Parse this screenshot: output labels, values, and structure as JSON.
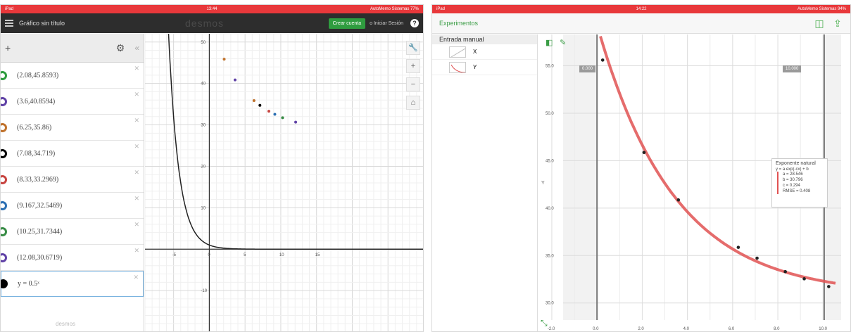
{
  "left": {
    "statusbar": {
      "left": "iPad",
      "center": "13:44",
      "right": "AutoMemo Sistemas  77%"
    },
    "header": {
      "title": "Gráfico sin título",
      "logo": "desmos",
      "create_account": "Crear cuenta",
      "login": "o Iniciar Sesión",
      "help": "?"
    },
    "toolbar": {
      "add": "+",
      "settings": "⚙",
      "collapse": "«"
    },
    "expressions": [
      {
        "text": "(2.08,45.8593)",
        "color": "#2f9c3f"
      },
      {
        "text": "(3.6,40.8594)",
        "color": "#6042a6"
      },
      {
        "text": "(6.25,35.86)",
        "color": "#c0722c"
      },
      {
        "text": "(7.08,34.719)",
        "color": "#000000"
      },
      {
        "text": "(8.33,33.2969)",
        "color": "#c74440"
      },
      {
        "text": "(9.167,32.5469)",
        "color": "#2d70b3"
      },
      {
        "text": "(10.25,31.7344)",
        "color": "#388c46"
      },
      {
        "text": "(12.08,30.6719)",
        "color": "#6042a6"
      }
    ],
    "function_expr": "y = 0.5ˣ",
    "footer": "desmos",
    "graph_tools": {
      "wrench": "🔧",
      "zoom_in": "+",
      "zoom_out": "−",
      "home": "⌂"
    },
    "chart_data": {
      "type": "scatter",
      "xlim": [
        -9,
        30
      ],
      "ylim": [
        -20,
        52
      ],
      "x_ticks": [
        "-5",
        "0",
        "5",
        "10",
        "15"
      ],
      "y_ticks": [
        "-10",
        "10",
        "20",
        "30",
        "40",
        "50"
      ],
      "points": [
        {
          "x": 2.08,
          "y": 45.8593,
          "color": "#c0722c"
        },
        {
          "x": 3.6,
          "y": 40.8594,
          "color": "#6042a6"
        },
        {
          "x": 6.25,
          "y": 35.86,
          "color": "#c0722c"
        },
        {
          "x": 7.08,
          "y": 34.719,
          "color": "#000000"
        },
        {
          "x": 8.33,
          "y": 33.2969,
          "color": "#c74440"
        },
        {
          "x": 9.167,
          "y": 32.5469,
          "color": "#2d70b3"
        },
        {
          "x": 10.25,
          "y": 31.7344,
          "color": "#388c46"
        },
        {
          "x": 12.08,
          "y": 30.6719,
          "color": "#6042a6"
        }
      ],
      "function": "y = 0.5^x"
    }
  },
  "right": {
    "statusbar": {
      "left": "iPad",
      "center": "14:22",
      "right": "AutoMemo Sistemas  94%"
    },
    "header": {
      "title": "Experimentos"
    },
    "sidebar": {
      "heading": "Entrada manual",
      "rows": [
        {
          "label": "X"
        },
        {
          "label": "Y"
        }
      ]
    },
    "range_left": "0.000",
    "range_right": "10.000",
    "legend": {
      "title": "Exponente natural",
      "formula": "y = a exp(-cx) + b",
      "lines": [
        "a = 28.546",
        "b = 30.796",
        "c = 0.294",
        "RMSE = 0.408"
      ]
    },
    "chart_data": {
      "type": "scatter",
      "xlim": [
        -1.5,
        10.8
      ],
      "ylim": [
        28.2,
        58.3
      ],
      "x_ticks": [
        "-2.0",
        "0.0",
        "2.0",
        "4.0",
        "6.0",
        "8.0",
        "10.0"
      ],
      "y_ticks": [
        "30.0",
        "35.0",
        "40.0",
        "45.0",
        "50.0",
        "55.0"
      ],
      "ylabel": "Y",
      "points": [
        {
          "x": 0.25,
          "y": 55.6
        },
        {
          "x": 2.08,
          "y": 45.86
        },
        {
          "x": 3.6,
          "y": 40.86
        },
        {
          "x": 6.25,
          "y": 35.86
        },
        {
          "x": 7.08,
          "y": 34.72
        },
        {
          "x": 8.33,
          "y": 33.3
        },
        {
          "x": 9.167,
          "y": 32.55
        },
        {
          "x": 10.25,
          "y": 31.73
        }
      ],
      "fit": {
        "a": 28.546,
        "b": 30.796,
        "c": 0.294,
        "color": "#e05252"
      }
    }
  }
}
